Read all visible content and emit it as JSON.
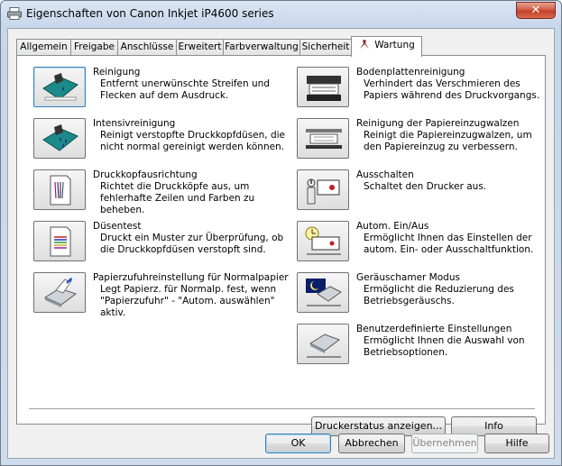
{
  "window": {
    "title": "Eigenschaften von Canon Inkjet iP4600 series",
    "close_symbol": "✕"
  },
  "tabs": [
    {
      "label": "Allgemein"
    },
    {
      "label": "Freigabe"
    },
    {
      "label": "Anschlüsse"
    },
    {
      "label": "Erweitert"
    },
    {
      "label": "Farbverwaltung"
    },
    {
      "label": "Sicherheit"
    },
    {
      "label": "Wartung",
      "active": true,
      "icon": "maintenance-tools-icon"
    }
  ],
  "left_items": [
    {
      "id": "reinigung",
      "title": "Reinigung",
      "desc": "Entfernt unerwünschte Streifen und Flecken auf dem Ausdruck.",
      "icon": "cleaning-icon"
    },
    {
      "id": "intensivreinigung",
      "title": "Intensivreinigung",
      "desc": "Reinigt verstopfte Druckkopfdüsen, die nicht normal gereinigt werden können.",
      "icon": "deep-cleaning-icon"
    },
    {
      "id": "druckkopfausrichtung",
      "title": "Druckkopfausrichtung",
      "desc": "Richtet die Druckköpfe aus, um fehlerhafte Zeilen und Farben zu beheben.",
      "icon": "print-head-alignment-icon"
    },
    {
      "id": "duesentest",
      "title": "Düsentest",
      "desc": "Druckt ein Muster zur Überprüfung, ob die Druckkopfdüsen verstopft sind.",
      "icon": "nozzle-check-icon"
    },
    {
      "id": "papierzufuhr",
      "title": "Papierzufuhreinstellung für Normalpapier",
      "desc": "Legt Papierz. für Normalp. fest, wenn \"Papierzufuhr\" - \"Autom. auswählen\" aktiv.",
      "icon": "paper-source-icon"
    }
  ],
  "right_items": [
    {
      "id": "bodenplatte",
      "title": "Bodenplattenreinigung",
      "desc": "Verhindert das Verschmieren des Papiers während des Druckvorgangs.",
      "icon": "bottom-plate-cleaning-icon"
    },
    {
      "id": "papiereinzugwalzen",
      "title": "Reinigung der Papiereinzugwalzen",
      "desc": "Reinigt die Papiereinzugwalzen, um den Papiereinzug zu verbessern.",
      "icon": "roller-cleaning-icon"
    },
    {
      "id": "ausschalten",
      "title": "Ausschalten",
      "desc": "Schaltet den Drucker aus.",
      "icon": "power-off-icon"
    },
    {
      "id": "autom-ein-aus",
      "title": "Autom. Ein/Aus",
      "desc": "Ermöglicht Ihnen das Einstellen der autom. Ein- oder Ausschaltfunktion.",
      "icon": "auto-power-icon"
    },
    {
      "id": "geraeuscharm",
      "title": "Geräuschamer Modus",
      "desc": "Ermöglicht die Reduzierung des Betriebsgeräuschs.",
      "icon": "quiet-mode-icon"
    },
    {
      "id": "benutzerdefiniert",
      "title": "Benutzerdefinierte Einstellungen",
      "desc": "Ermöglicht Ihnen die Auswahl von Betriebsoptionen.",
      "icon": "custom-settings-icon"
    }
  ],
  "panel_buttons": {
    "status": "Druckerstatus anzeigen...",
    "info": "Info"
  },
  "dialog_buttons": {
    "ok": "OK",
    "cancel": "Abbrechen",
    "apply": "Übernehmen",
    "help": "Hilfe"
  }
}
